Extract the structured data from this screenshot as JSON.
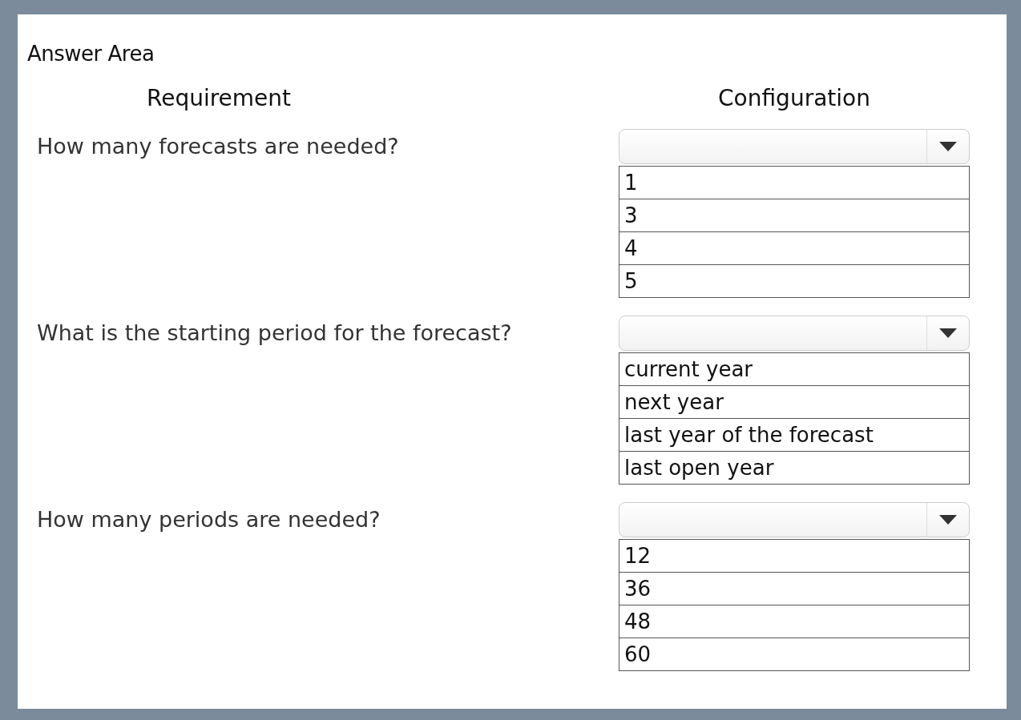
{
  "title": "Answer Area",
  "headers": [
    "Requirement",
    "Configuration"
  ],
  "questions": [
    {
      "text": "How many forecasts are needed?",
      "options": [
        "1",
        "3",
        "4",
        "5"
      ]
    },
    {
      "text": "What is the starting period for the forecast?",
      "options": [
        "current year",
        "next year",
        "last year of the forecast",
        "last open year"
      ]
    },
    {
      "text": "How many periods are needed?",
      "options": [
        "12",
        "36",
        "48",
        "60"
      ]
    }
  ]
}
